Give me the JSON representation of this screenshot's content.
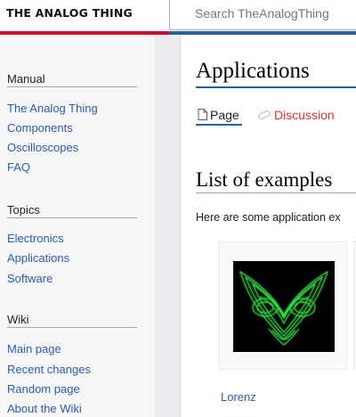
{
  "header": {
    "logo_text": "THE ANALOG THING",
    "search_placeholder": "Search TheAnalogThing",
    "accent_red": "#c8102e",
    "accent_blue": "#2d5d9a"
  },
  "sidebar": {
    "sections": [
      {
        "heading": "Manual",
        "links": [
          "The Analog Thing",
          "Components",
          "Oscilloscopes",
          "FAQ"
        ]
      },
      {
        "heading": "Topics",
        "links": [
          "Electronics",
          "Applications",
          "Software"
        ]
      },
      {
        "heading": "Wiki",
        "links": [
          "Main page",
          "Recent changes",
          "Random page",
          "About the Wiki"
        ]
      }
    ]
  },
  "main": {
    "title": "Applications",
    "tabs": {
      "page": "Page",
      "discussion": "Discussion"
    },
    "section_title": "List of examples",
    "intro": "Here are some application ex",
    "gallery": [
      {
        "caption": "Lorenz",
        "image": "lorenz-attractor-oscilloscope-trace"
      },
      {
        "caption": "S"
      }
    ],
    "link_color": "#2a5db0",
    "discussion_color": "#dd3333"
  }
}
